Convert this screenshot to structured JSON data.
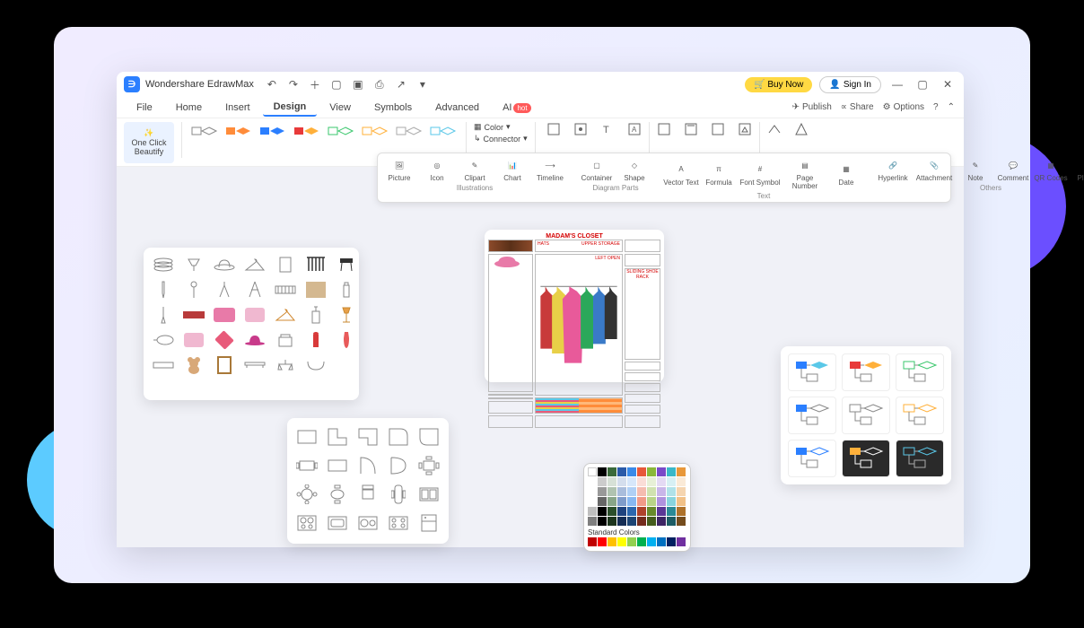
{
  "app": {
    "title": "Wondershare EdrawMax"
  },
  "titlebar": {
    "buy": "Buy Now",
    "signin": "Sign In"
  },
  "menu": {
    "items": [
      "File",
      "Home",
      "Insert",
      "Design",
      "View",
      "Symbols",
      "Advanced",
      "AI"
    ],
    "hot": "hot",
    "right": {
      "publish": "Publish",
      "share": "Share",
      "options": "Options"
    }
  },
  "ribbon": {
    "beautify": "One Click Beautify",
    "color": "Color",
    "connector": "Connector"
  },
  "insert_toolbar": {
    "groups": {
      "illustrations": "Illustrations",
      "diagram_parts": "Diagram Parts",
      "text": "Text",
      "others": "Others"
    },
    "items": {
      "picture": "Picture",
      "icon": "Icon",
      "clipart": "Clipart",
      "chart": "Chart",
      "timeline": "Timeline",
      "container": "Container",
      "shape": "Shape",
      "vector_text": "Vector Text",
      "formula": "Formula",
      "font_symbol": "Font Symbol",
      "page_number": "Page Number",
      "date": "Date",
      "hyperlink": "Hyperlink",
      "attachment": "Attachment",
      "note": "Note",
      "comment": "Comment",
      "qr_codes": "QR Codes",
      "plugin": "Plug-in"
    }
  },
  "closet": {
    "title": "MADAM'S CLOSET",
    "upper": "UPPER STORAGE",
    "hats": "HATS",
    "open": "LEFT OPEN",
    "shoe": "SLIDING SHOE RACK"
  },
  "colors": {
    "standard": "Standard Colors"
  }
}
